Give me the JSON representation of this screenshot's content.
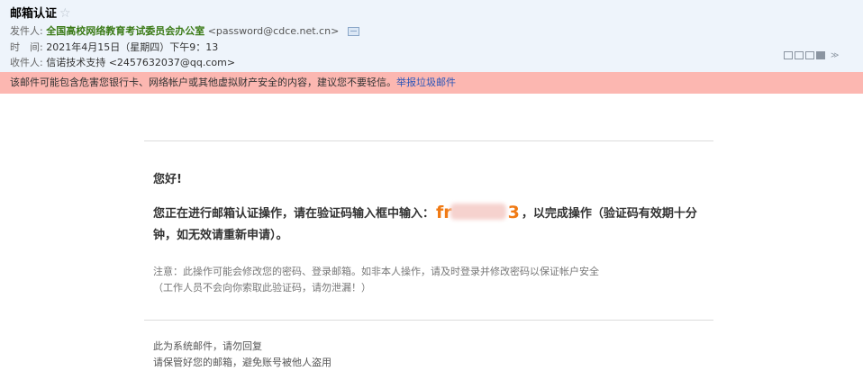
{
  "email": {
    "subject": "邮箱认证",
    "star": "☆",
    "from_label": "发件人:",
    "from_name": "全国高校网络教育考试委员会办公室",
    "from_address": "<password@cdce.net.cn>",
    "time_label": "时　间:",
    "time_value": "2021年4月15日（星期四）下午9：13",
    "to_label": "收件人:",
    "to_value": "信诺技术支持 <2457632037@qq.com>"
  },
  "toolbar": {
    "icons": [
      "restore-window-icon",
      "new-window-icon",
      "print-preview-icon",
      "print-icon",
      "chevron-down-icon"
    ],
    "chevron": "≫"
  },
  "warning": {
    "text": "该邮件可能包含危害您银行卡、网络帐户或其他虚拟财产安全的内容，建议您不要轻信。",
    "link": "举报垃圾邮件"
  },
  "content": {
    "greeting": "您好!",
    "line1_before": "您正在进行邮箱认证操作，请在验证码输入框中输入：",
    "code_start": "fr",
    "code_end": "3",
    "line1_after": "，以完成操作（验证码有效期十分",
    "line2": "钟，如无效请重新申请）。",
    "note1": "注意：此操作可能会修改您的密码、登录邮箱。如非本人操作，请及时登录并修改密码以保证帐户安全",
    "note2": "（工作人员不会向你索取此验证码，请勿泄漏！）",
    "footer1": "此为系统邮件，请勿回复",
    "footer2": "请保管好您的邮箱，避免账号被他人盗用"
  },
  "colors": {
    "header_bg": "#eef4fb",
    "warning_bg": "#fcb7b1",
    "sender_green": "#3a7a16",
    "link_blue": "#2a55b8",
    "code_orange": "#f07a14"
  }
}
